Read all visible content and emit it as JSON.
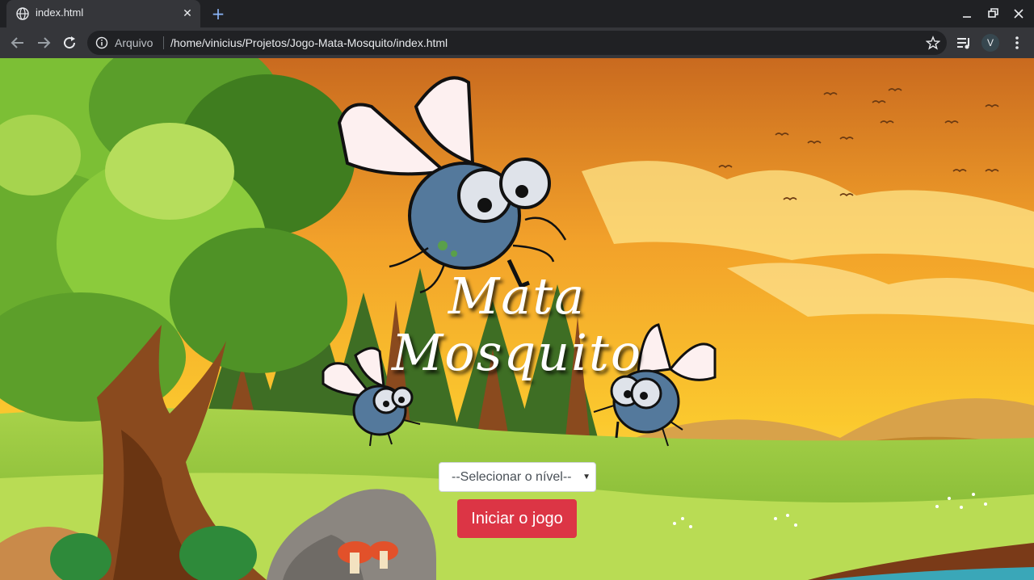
{
  "browser": {
    "tab_title": "index.html",
    "scheme_label": "Arquivo",
    "url": "/home/vinicius/Projetos/Jogo-Mata-Mosquito/index.html",
    "profile_initial": "V"
  },
  "game": {
    "title_line1": "Mata",
    "title_line2": "Mosquito",
    "level_select_value": "--Selecionar o nível--",
    "start_button": "Iniciar o jogo"
  },
  "colors": {
    "start_button": "#dc3545",
    "sky_top": "#c96a1f",
    "sky_bottom": "#f9c12a",
    "grass": "#8cc43c"
  }
}
